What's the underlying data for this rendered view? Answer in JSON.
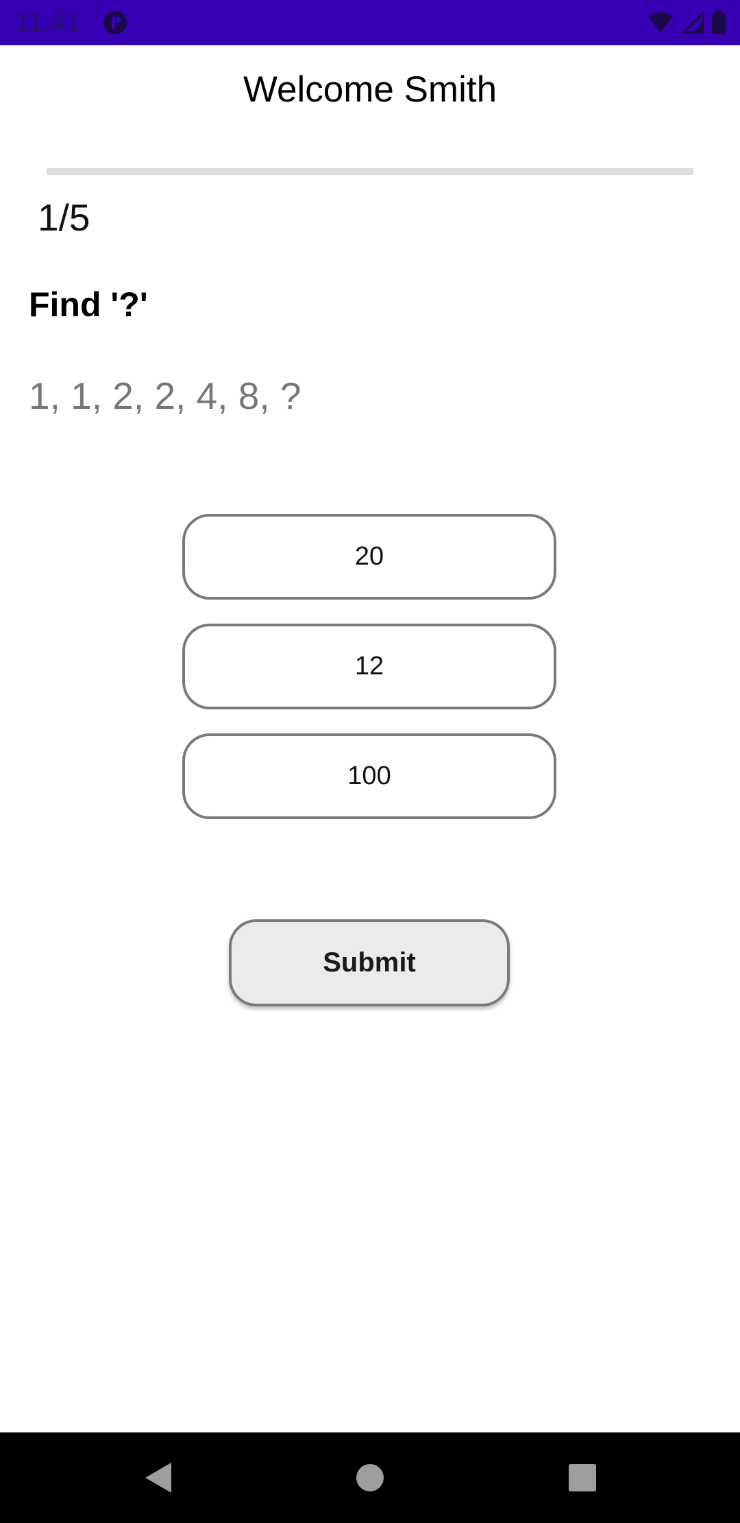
{
  "status_bar": {
    "time": "11:41",
    "icons": [
      "app-notification-icon",
      "wifi-icon",
      "signal-icon",
      "battery-icon"
    ],
    "background": "#3700b3"
  },
  "header": {
    "title": "Welcome Smith"
  },
  "quiz": {
    "progress_fraction": 0.0,
    "counter": "1/5",
    "question": "Find '?'",
    "sequence": "1, 1, 2, 2, 4, 8, ?",
    "options": [
      "20",
      "12",
      "100"
    ],
    "submit_label": "Submit"
  },
  "nav_bar": {
    "icons": [
      "back-icon",
      "home-icon",
      "recents-icon"
    ]
  }
}
